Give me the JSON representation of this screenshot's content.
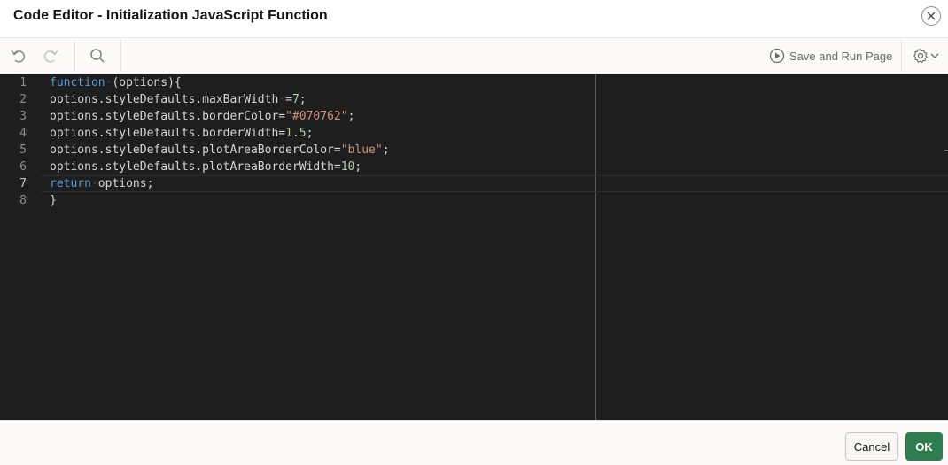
{
  "dialog": {
    "title": "Code Editor - Initialization JavaScript Function"
  },
  "toolbar": {
    "icons": [
      "undo-icon",
      "redo-icon",
      "search-icon",
      "play-circle-icon",
      "gear-icon",
      "chevron-down-icon"
    ],
    "save_run_label": "Save and Run Page"
  },
  "editor": {
    "active_line": 7,
    "line_numbers": [
      "1",
      "2",
      "3",
      "4",
      "5",
      "6",
      "7",
      "8"
    ],
    "lines": [
      [
        {
          "t": "kw",
          "v": "function"
        },
        {
          "t": "ws",
          "v": "·"
        },
        {
          "t": "p",
          "v": "(options){"
        }
      ],
      [
        {
          "t": "p",
          "v": "options.styleDefaults.maxBarWidth"
        },
        {
          "t": "ws",
          "v": "·"
        },
        {
          "t": "p",
          "v": "="
        },
        {
          "t": "num",
          "v": "7"
        },
        {
          "t": "p",
          "v": ";"
        }
      ],
      [
        {
          "t": "p",
          "v": "options.styleDefaults.borderColor="
        },
        {
          "t": "str",
          "v": "\"#070762\""
        },
        {
          "t": "p",
          "v": ";"
        }
      ],
      [
        {
          "t": "p",
          "v": "options.styleDefaults.borderWidth="
        },
        {
          "t": "num",
          "v": "1.5"
        },
        {
          "t": "p",
          "v": ";"
        }
      ],
      [
        {
          "t": "p",
          "v": "options.styleDefaults.plotAreaBorderColor="
        },
        {
          "t": "str",
          "v": "\"blue\""
        },
        {
          "t": "p",
          "v": ";"
        }
      ],
      [
        {
          "t": "p",
          "v": "options.styleDefaults.plotAreaBorderWidth="
        },
        {
          "t": "num",
          "v": "10"
        },
        {
          "t": "p",
          "v": ";"
        }
      ],
      [
        {
          "t": "kw",
          "v": "return"
        },
        {
          "t": "ws",
          "v": "·"
        },
        {
          "t": "p",
          "v": "options;"
        }
      ],
      [
        {
          "t": "p",
          "v": "}"
        }
      ]
    ]
  },
  "footer": {
    "cancel_label": "Cancel",
    "ok_label": "OK"
  },
  "colors": {
    "editor_bg": "#1e1e1e",
    "keyword": "#569cd6",
    "string": "#ce9178",
    "number": "#b5cea8",
    "ok_button": "#2f7d4f"
  }
}
